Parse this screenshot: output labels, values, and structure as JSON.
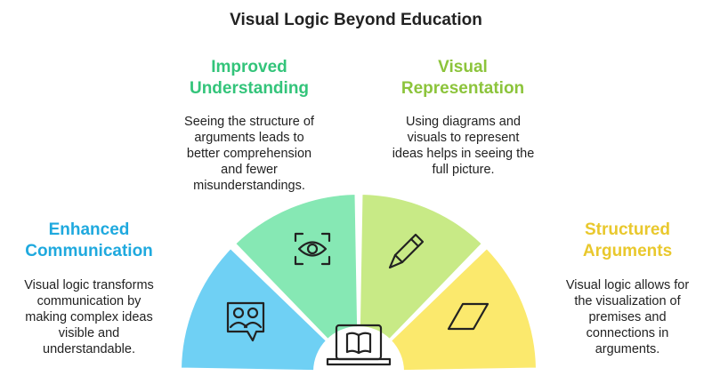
{
  "title": "Visual Logic Beyond Education",
  "sections": [
    {
      "heading": "Enhanced\nCommunication",
      "description": "Visual logic transforms\ncommunication by\nmaking complex ideas\nvisible and\nunderstandable.",
      "color": "#1fa9de",
      "fill": "#6fd0f4",
      "icon": "chat-people-icon"
    },
    {
      "heading": "Improved\nUnderstanding",
      "description": "Seeing the structure of\narguments leads to\nbetter comprehension\nand fewer\nmisunderstandings.",
      "color": "#33c47a",
      "fill": "#86e8b4",
      "icon": "eye-icon"
    },
    {
      "heading": "Visual\nRepresentation",
      "description": "Using diagrams and\nvisuals to represent\nideas helps in seeing the\nfull picture.",
      "color": "#8cc43b",
      "fill": "#c8ea86",
      "icon": "pencil-icon"
    },
    {
      "heading": "Structured\nArguments",
      "description": "Visual logic allows for\nthe visualization of\npremises and\nconnections in\narguments.",
      "color": "#e9c82d",
      "fill": "#fbe96d",
      "icon": "parallelogram-icon"
    }
  ],
  "center_icon": "laptop-book-icon",
  "stroke_color": "#222222"
}
